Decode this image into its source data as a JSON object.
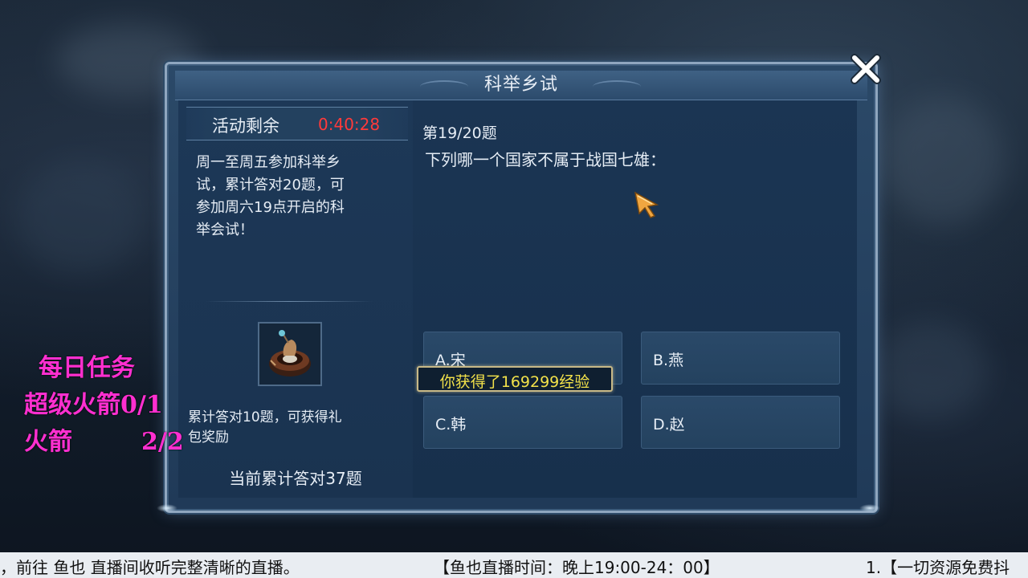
{
  "dialog": {
    "title": "科举乡试"
  },
  "left": {
    "timer_label": "活动剩余",
    "timer_value": "0:40:28",
    "description_lines": [
      "周一至周五参加科举乡",
      "试，累计答对20题，可",
      "参加周六19点开启的科",
      "举会试！"
    ],
    "reward_icon": "gift-bag-icon",
    "reward_desc_lines": [
      "累计答对10题，可获得礼",
      "包奖励"
    ],
    "total_correct": "当前累计答对37题"
  },
  "question": {
    "number": "第19/20题",
    "text": "下列哪一个国家不属于战国七雄：",
    "options": [
      {
        "label": "A.宋"
      },
      {
        "label": "B.燕"
      },
      {
        "label": "C.韩"
      },
      {
        "label": "D.赵"
      }
    ]
  },
  "toast": {
    "text": "你获得了169299经验"
  },
  "overlay": {
    "daily_title": "每日任务",
    "super_rocket": "超级火箭0/1",
    "rocket_label": "火箭",
    "rocket_count": "2/2",
    "color": "#ff2fd0"
  },
  "ticker": {
    "segment1": "，前往 鱼也 直播间收听完整清晰的直播。",
    "segment2": "【鱼也直播时间：晚上19:00-24：00】",
    "segment3": "1.【一切资源免费抖"
  },
  "colors": {
    "timer": "#ff3a3a",
    "toast_text": "#f3e24a",
    "toast_border": "#c8b987",
    "panel": "#203a58"
  }
}
